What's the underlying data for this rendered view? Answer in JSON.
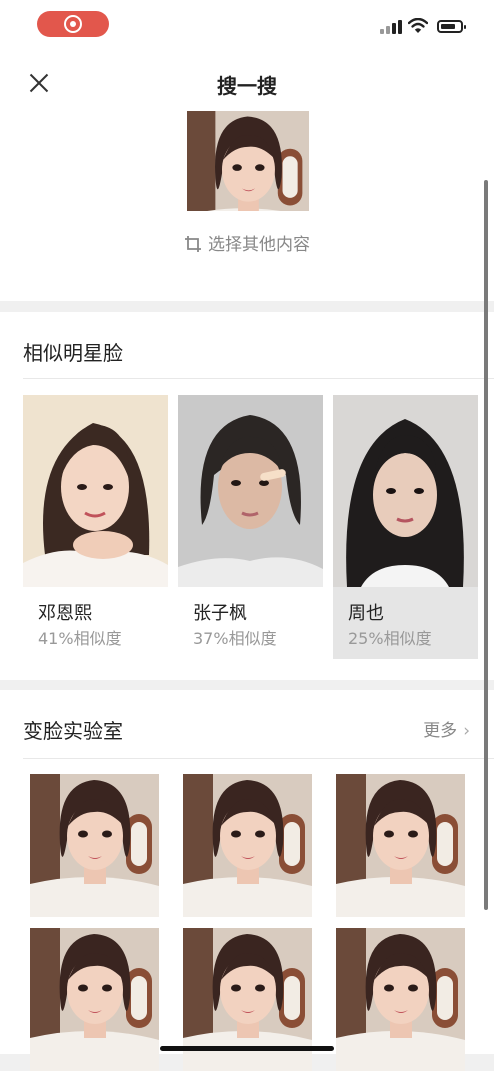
{
  "header": {
    "title": "搜一搜"
  },
  "query": {
    "change_label": "选择其他内容"
  },
  "similar": {
    "title": "相似明星脸",
    "cards": [
      {
        "name": "邓恩熙",
        "similarity": "41%相似度"
      },
      {
        "name": "张子枫",
        "similarity": "37%相似度"
      },
      {
        "name": "周也",
        "similarity": "25%相似度"
      }
    ]
  },
  "lab": {
    "title": "变脸实验室",
    "more_label": "更多"
  },
  "colors": {
    "accent": "#e2574c",
    "panel": "#ffffff",
    "page_bg": "#f0f0f0",
    "muted_text": "#999999"
  }
}
